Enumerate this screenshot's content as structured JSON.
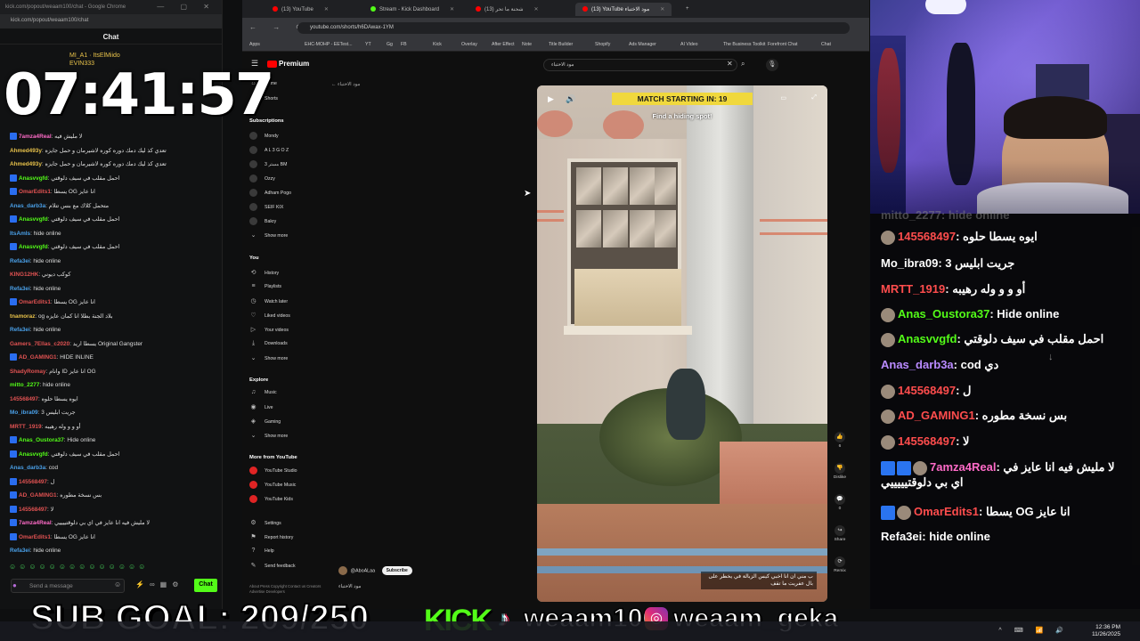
{
  "left_chat": {
    "window_title": "kick.com/popout/weaam100/chat - Google Chrome",
    "url": "kick.com/popout/weaam100/chat",
    "header": "Chat",
    "pinned": [
      "MI_A1",
      "ItsElMiido",
      "EVIN333"
    ],
    "messages": [
      {
        "user": "7amza4Real",
        "text": "لا مليش فيه",
        "color": "#ff6bc8",
        "badge": true
      },
      {
        "user": "Ahmed493y",
        "text": "تعدي كذ ليك دمك دوره كوره لاشيرمان و حمل جايزه",
        "color": "#e8c24a",
        "badge": false
      },
      {
        "user": "Ahmed493y",
        "text": "تعدي كذ ليك دمك دوره كوره لاشيرمان و حمل جايزه",
        "color": "#e8c24a",
        "badge": false
      },
      {
        "user": "Anasvvgfd",
        "text": "احمل مقلب في سيف دلوقتي",
        "color": "#53fc18",
        "badge": true
      },
      {
        "user": "OmarEdits1",
        "text": "يسطا OG انا عايز",
        "color": "#e05252",
        "badge": true
      },
      {
        "user": "Anas_darb3a",
        "text": "متحمل كلاك مع بنس تتلام",
        "color": "#4aa0e8",
        "badge": false
      },
      {
        "user": "Anasvvgfd",
        "text": "احمل مقلب في سيف دلوقتي",
        "color": "#53fc18",
        "badge": true
      },
      {
        "user": "ItsAmIs",
        "text": "hide online",
        "color": "#4aa0e8",
        "badge": false
      },
      {
        "user": "Anasvvgfd",
        "text": "احمل مقلب في سيف دلوقتي",
        "color": "#53fc18",
        "badge": true
      },
      {
        "user": "Refa3ei",
        "text": "hide online",
        "color": "#4aa0e8",
        "badge": false
      },
      {
        "user": "KING12HK",
        "text": "كوكب ديوني",
        "color": "#e05252",
        "badge": false
      },
      {
        "user": "Refa3ei",
        "text": "hide online",
        "color": "#4aa0e8",
        "badge": false
      },
      {
        "user": "OmarEdits1",
        "text": "يسطا OG انا عايز",
        "color": "#e05252",
        "badge": true
      },
      {
        "user": "tnamoraz",
        "text": "og بلاد الجنة بطلا انا كمان عايزه",
        "color": "#e8c24a",
        "badge": false
      },
      {
        "user": "Refa3ei",
        "text": "hide online",
        "color": "#4aa0e8",
        "badge": false
      },
      {
        "user": "Gamers_7Ellas_c2020",
        "text": "يسطا اريد Original Gangster",
        "color": "#e05252",
        "badge": false
      },
      {
        "user": "AD_GAMING1",
        "text": "HIDE INLINE",
        "color": "#e05252",
        "badge": true
      },
      {
        "user": "ShadyRomay",
        "text": "وانام ID انا عايز OG",
        "color": "#e05252",
        "badge": false
      },
      {
        "user": "mitto_2277",
        "text": "hide online",
        "color": "#53fc18",
        "badge": false
      },
      {
        "user": "145568497",
        "text": "ايوه يسطا حلوه",
        "color": "#e05252",
        "badge": false
      },
      {
        "user": "Mo_ibra09",
        "text": "جريت ابليس 3",
        "color": "#4aa0e8",
        "badge": false
      },
      {
        "user": "MRTT_1919",
        "text": "أو و و وله رهيبه",
        "color": "#e05252",
        "badge": false
      },
      {
        "user": "Anas_Oustora37",
        "text": "Hide online",
        "color": "#53fc18",
        "badge": true
      },
      {
        "user": "Anasvvgfd",
        "text": "احمل مقلب في سيف دلوقتي",
        "color": "#53fc18",
        "badge": true
      },
      {
        "user": "Anas_darb3a",
        "text": "cod",
        "color": "#4aa0e8",
        "badge": false
      },
      {
        "user": "145568497",
        "text": "ل",
        "color": "#e05252",
        "badge": true
      },
      {
        "user": "AD_GAMING1",
        "text": "بس نسخة مطوره",
        "color": "#e05252",
        "badge": true
      },
      {
        "user": "145568497",
        "text": "لا",
        "color": "#e05252",
        "badge": true
      },
      {
        "user": "7amza4Real",
        "text": "لا مليش فيه انا عايز في اي بي دلوقتييييي",
        "color": "#ff6bc8",
        "badge": true
      },
      {
        "user": "OmarEdits1",
        "text": "يسطا OG انا عايز",
        "color": "#e05252",
        "badge": true
      },
      {
        "user": "Refa3ei",
        "text": "hide online",
        "color": "#4aa0e8",
        "badge": false
      }
    ],
    "input_placeholder": "Send a message",
    "chat_button": "Chat",
    "accent": "#53fc18"
  },
  "clock_overlay": "07:41:57",
  "browser": {
    "tabs": [
      {
        "title": "(13) YouTube",
        "dot": "#ff0000",
        "active": false
      },
      {
        "title": "Stream - Kick Dashboard",
        "dot": "#53fc18",
        "active": false
      },
      {
        "title": "(13) شحنة ما تحر",
        "dot": "#ff0000",
        "active": false
      },
      {
        "title": "(13) YouTube مود الاختباء",
        "dot": "#ff0000",
        "active": true
      }
    ],
    "url": "youtube.com/shorts/h6DAwax-1YM",
    "bookmarks": [
      "Apps",
      "EHC-MOHP - EETest...",
      "YT",
      "Gg",
      "FB",
      "Kick",
      "Overlay",
      "After Effect",
      "Note",
      "Title Builder",
      "Shopify",
      "Ads Manager",
      "AI Video",
      "The Business Toolkit",
      "Forefront Chat",
      "Chat"
    ]
  },
  "youtube": {
    "logo": "Premium",
    "search_value": "مود الاختباء",
    "back_label": "مود الاختباء",
    "sidebar": {
      "top": [
        "Home",
        "Shorts"
      ],
      "subscriptions_label": "Subscriptions",
      "subscriptions": [
        "Mondy",
        "A L 3 G O Z",
        "3 مستر BM",
        "Ozzy",
        "Adham Pogo",
        "SEIF KIX",
        "Bakry"
      ],
      "show_more": "Show more",
      "you_label": "You",
      "you_items": [
        "History",
        "Playlists",
        "Watch later",
        "Liked videos",
        "Your videos",
        "Downloads",
        "Show more"
      ],
      "explore_label": "Explore",
      "explore_items": [
        "Music",
        "Live",
        "Gaming",
        "Show more"
      ],
      "more_label": "More from YouTube",
      "more_items": [
        "YouTube Studio",
        "YouTube Music",
        "YouTube Kids"
      ],
      "settings_items": [
        "Settings",
        "Report history",
        "Help",
        "Send feedback"
      ],
      "footer": "About Press Copyright Contact us Creators Advertise Developers"
    },
    "short": {
      "banner": "MATCH STARTING IN: 19",
      "subtitle": "Find a hiding spot!",
      "caption": "ب مني ان انا اخبي كيس الزبالة في يخطر على بال عفريت ما تقف"
    },
    "actions": [
      {
        "icon": "like-icon",
        "label": "6",
        "glyph": "👍"
      },
      {
        "icon": "dislike-icon",
        "label": "Dislike",
        "glyph": "👎"
      },
      {
        "icon": "comment-icon",
        "label": "0",
        "glyph": "💬"
      },
      {
        "icon": "share-icon",
        "label": "Share",
        "glyph": "↪"
      },
      {
        "icon": "remix-icon",
        "label": "Remix",
        "glyph": "⟳"
      }
    ],
    "channel": "@AboALaa",
    "subscribe": "Subscribe",
    "video_title": "مود الاختباء"
  },
  "right_chat": {
    "top_partial": "mitto_2277: hide online",
    "messages": [
      {
        "user": "145568497",
        "text": "ايوه يسطا حلوه",
        "color": "#ff4d4d",
        "avatar": true,
        "badges": 0
      },
      {
        "user": "Mo_ibra09",
        "text": "جريت ابليس 3",
        "color": "#ffffff",
        "avatar": false,
        "badges": 0
      },
      {
        "user": "MRTT_1919",
        "text": "أو و و وله رهيبه",
        "color": "#ff4d4d",
        "avatar": false,
        "badges": 0
      },
      {
        "user": "Anas_Oustora37",
        "text": "Hide online",
        "color": "#53fc18",
        "avatar": true,
        "badges": 0
      },
      {
        "user": "Anasvvgfd",
        "text": "احمل مقلب في سيف دلوقتي",
        "color": "#53fc18",
        "avatar": true,
        "badges": 0
      },
      {
        "user": "Anas_darb3a",
        "text": "cod دي",
        "color": "#b98aff",
        "avatar": false,
        "badges": 0
      },
      {
        "user": "145568497",
        "text": "ل",
        "color": "#ff4d4d",
        "avatar": true,
        "badges": 0
      },
      {
        "user": "AD_GAMING1",
        "text": "بس نسخة مطوره",
        "color": "#ff4d4d",
        "avatar": true,
        "badges": 0
      },
      {
        "user": "145568497",
        "text": "لا",
        "color": "#ff4d4d",
        "avatar": true,
        "badges": 0
      },
      {
        "user": "7amza4Real",
        "text": "لا مليش فيه انا عايز في",
        "text2": "اي بي دلوقتيييييي",
        "color": "#ff6bc8",
        "avatar": true,
        "badges": 2
      },
      {
        "user": "OmarEdits1",
        "text": "يسطا OG انا عايز",
        "color": "#ff4d4d",
        "avatar": true,
        "badges": 1
      },
      {
        "user": "Refa3ei",
        "text": "hide online",
        "color": "#ffffff",
        "avatar": false,
        "badges": 0
      }
    ]
  },
  "ticker": {
    "sub_goal": "SUB GOAL: 209/250",
    "kick_logo": "KICK",
    "handle1": "weaam100",
    "handle2": "weaam_geka"
  },
  "taskbar": {
    "time": "12:36 PM",
    "date": "11/26/2025"
  }
}
